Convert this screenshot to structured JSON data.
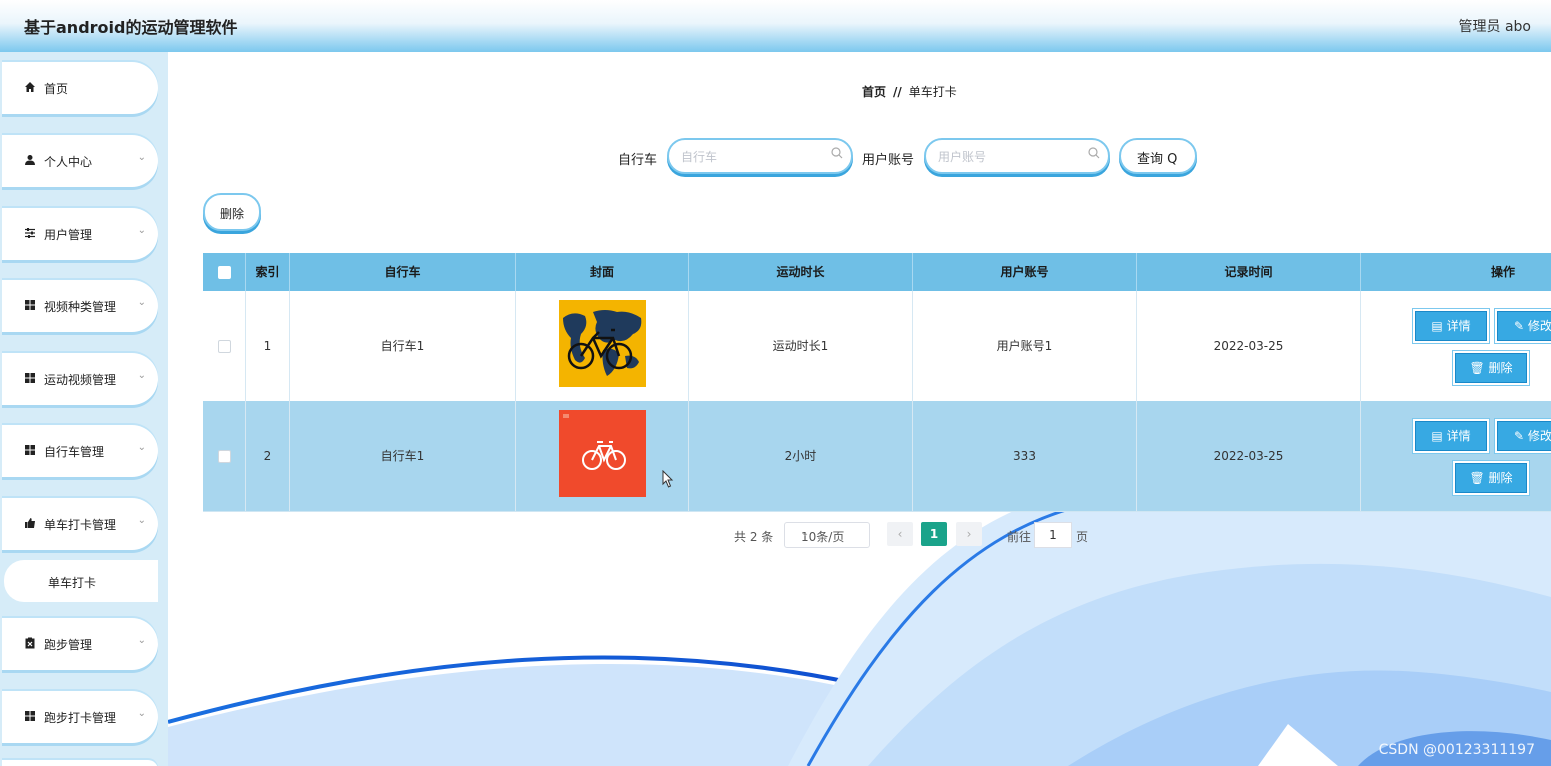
{
  "header": {
    "title": "基于android的运动管理软件",
    "user": "管理员 abo"
  },
  "sidebar": {
    "items": [
      {
        "label": "首页",
        "icon": "home-icon",
        "chevron": false
      },
      {
        "label": "个人中心",
        "icon": "user-icon",
        "chevron": true
      },
      {
        "label": "用户管理",
        "icon": "sliders-icon",
        "chevron": true
      },
      {
        "label": "视频种类管理",
        "icon": "grid-icon",
        "chevron": true
      },
      {
        "label": "运动视频管理",
        "icon": "grid-icon",
        "chevron": true
      },
      {
        "label": "自行车管理",
        "icon": "grid-icon",
        "chevron": true
      },
      {
        "label": "单车打卡管理",
        "icon": "thumb-icon",
        "chevron": true
      },
      {
        "label": "跑步管理",
        "icon": "clipboard-icon",
        "chevron": true
      },
      {
        "label": "跑步打卡管理",
        "icon": "grid-icon",
        "chevron": true
      }
    ],
    "sub_active": "单车打卡"
  },
  "breadcrumb": {
    "home": "首页",
    "sep": "//",
    "current": "单车打卡"
  },
  "search": {
    "bike_label": "自行车",
    "bike_placeholder": "自行车",
    "account_label": "用户账号",
    "account_placeholder": "用户账号",
    "query_label": "查询 Q"
  },
  "delete_label": "删除",
  "table": {
    "headers": [
      "索引",
      "自行车",
      "封面",
      "运动时长",
      "用户账号",
      "记录时间",
      "操作"
    ],
    "rows": [
      {
        "index": "1",
        "bike": "自行车1",
        "duration": "运动时长1",
        "account": "用户账号1",
        "time": "2022-03-25"
      },
      {
        "index": "2",
        "bike": "自行车1",
        "duration": "2小时",
        "account": "333",
        "time": "2022-03-25"
      }
    ],
    "ops": {
      "detail": "详情",
      "edit": "修改",
      "delete": "删除"
    }
  },
  "pager": {
    "total": "共 2 条",
    "page_size": "10条/页",
    "current": "1",
    "goto": "前往",
    "goto_value": "1",
    "page_unit": "页"
  },
  "watermark": "CSDN @00123311197",
  "colors": {
    "header_blue": "#7cc8ee",
    "table_head": "#6fbfe6",
    "op_button": "#37a9e3",
    "page_active": "#1aa38a"
  }
}
